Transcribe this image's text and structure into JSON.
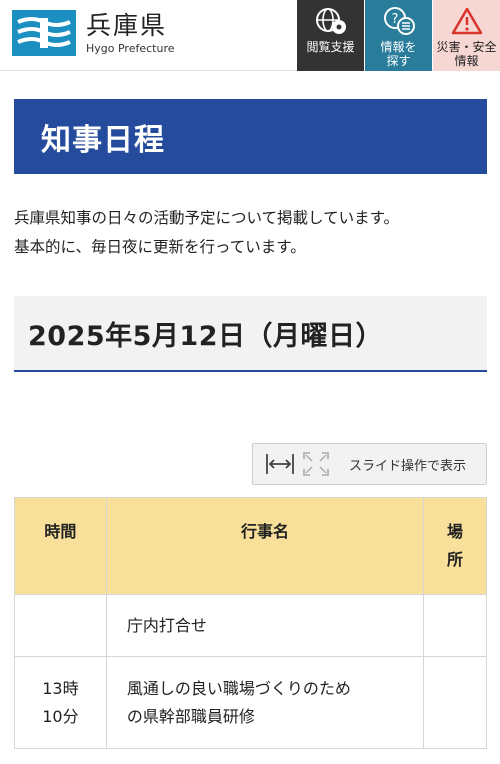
{
  "header": {
    "logo_title": "兵庫県",
    "logo_subtitle": "Hygo Prefecture",
    "buttons": [
      {
        "label": "閲覧支援",
        "icon": "globe-gear-icon"
      },
      {
        "label": "情報を\n探す",
        "icon": "question-list-icon"
      },
      {
        "label": "災害・安全\n情報",
        "icon": "warning-triangle-icon"
      }
    ]
  },
  "page": {
    "title": "知事日程",
    "intro_line1": "兵庫県知事の日々の活動予定について掲載しています。",
    "intro_line2": "基本的に、毎日夜に更新を行っています。",
    "date_heading": "2025年5月12日（月曜日）"
  },
  "slide_button": {
    "label": "スライド操作で表示"
  },
  "table": {
    "headers": {
      "time": "時間",
      "event": "行事名",
      "place": "場所"
    },
    "rows": [
      {
        "time": "",
        "event": "庁内打合せ",
        "place": ""
      },
      {
        "time": "13時\n10分",
        "event": "風通しの良い職場づくりのため\nの県幹部職員研修",
        "place": ""
      }
    ]
  },
  "colors": {
    "title_bar": "#244b9c",
    "table_header": "#f8e09a",
    "accessibility_bg": "#333333",
    "search_bg": "#2a7c9b",
    "disaster_bg": "#f6d7d3",
    "logo_blue": "#1b8fc0"
  }
}
